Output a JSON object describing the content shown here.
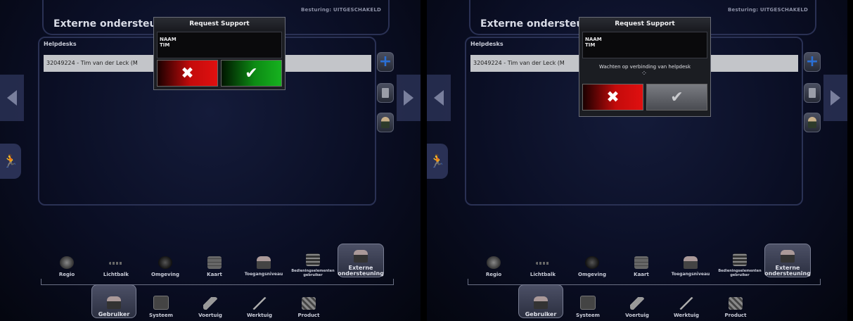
{
  "status": "Besturing: UITGESCHAKELD",
  "page_title": "Externe ondersteuning",
  "panel_label": "Helpdesks",
  "helpdesk_entry": "32049224 - Tim van der Leck (M",
  "dialog": {
    "title": "Request Support",
    "name_label": "NAAM",
    "name_value": "TIM",
    "waiting_text": "Wachten op verbinding van helpdesk",
    "spinner": "⁘",
    "cancel_glyph": "✖",
    "confirm_glyph": "✔"
  },
  "side_icons": [
    "plus-icon",
    "trash-icon",
    "user-icon"
  ],
  "walk_glyph": "🏃",
  "settings_tabs": [
    "Regio",
    "Lichtbalk",
    "Omgeving",
    "Kaart",
    "Toegangsniveau",
    "Bedieningselementen gebruiker",
    "Externe ondersteuning"
  ],
  "category_tabs": [
    "Gebruiker",
    "Systeem",
    "Voertuig",
    "Werktuig",
    "Product"
  ],
  "colors": {
    "cancel": "#d10c0c",
    "confirm": "#14a31c",
    "accent_plus": "#2a6fd6"
  }
}
